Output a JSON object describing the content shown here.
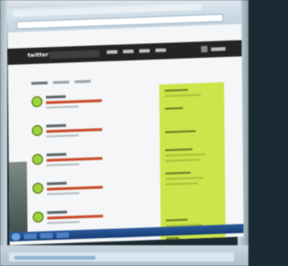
{
  "scene": {
    "description_free": true
  },
  "site": {
    "logo_text": "twitter"
  }
}
